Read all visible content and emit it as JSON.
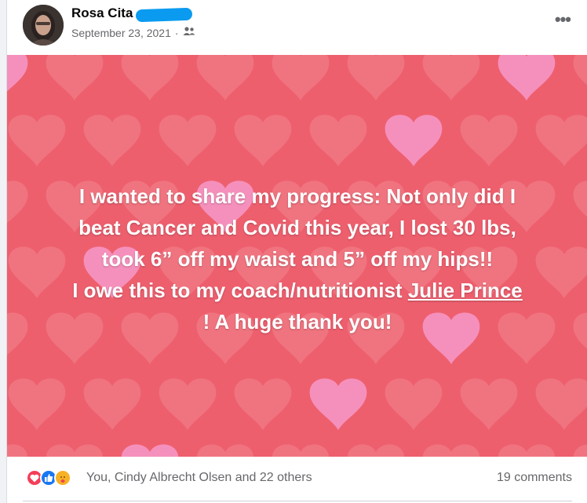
{
  "post": {
    "author": "Rosa Cita",
    "date": "September 23, 2021",
    "separator": "·",
    "audience_icon": "friends-icon",
    "more_icon": "more-options-icon",
    "text_line1": "I wanted to share my progress: Not only did I",
    "text_line2": "beat Cancer and Covid this year, I lost 30 lbs,",
    "text_line3": "took 6” off my waist and 5” off my hips!!",
    "text_line4_prefix": "I owe this to my coach/nutritionist ",
    "text_mention": "Julie Prince",
    "text_line5": "! A huge thank you!",
    "background": "#ee5f6e",
    "heart_colors": [
      "#f07b86",
      "#f596c4"
    ]
  },
  "footer": {
    "reaction_icons": [
      "love-icon",
      "like-icon",
      "care-icon"
    ],
    "reactions_text": "You, Cindy Albrecht Olsen and 22 others",
    "comments_text": "19 comments"
  }
}
